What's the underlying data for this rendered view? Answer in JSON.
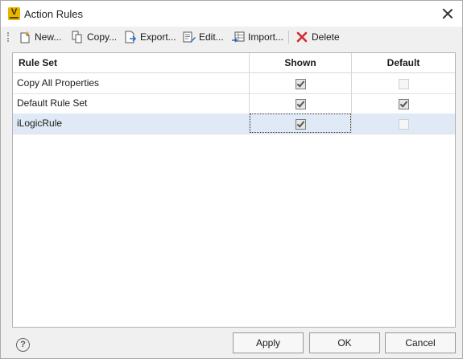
{
  "window": {
    "title": "Action Rules",
    "app_icon_letter": "V"
  },
  "toolbar": {
    "new_label": "New...",
    "copy_label": "Copy...",
    "export_label": "Export...",
    "edit_label": "Edit...",
    "import_label": "Import...",
    "delete_label": "Delete"
  },
  "table": {
    "columns": [
      "Rule Set",
      "Shown",
      "Default"
    ],
    "rows": [
      {
        "name": "Copy All Properties",
        "shown": true,
        "default": false,
        "default_enabled": false
      },
      {
        "name": "Default Rule Set",
        "shown": true,
        "default": true,
        "default_enabled": true
      },
      {
        "name": "iLogicRule",
        "shown": true,
        "default": false,
        "default_enabled": false,
        "selected": true
      }
    ]
  },
  "footer": {
    "help_symbol": "?",
    "apply_label": "Apply",
    "ok_label": "OK",
    "cancel_label": "Cancel"
  },
  "colors": {
    "accent_selection": "#dfeaf6",
    "delete_red": "#d42a2a",
    "app_icon": "#e8b400"
  }
}
